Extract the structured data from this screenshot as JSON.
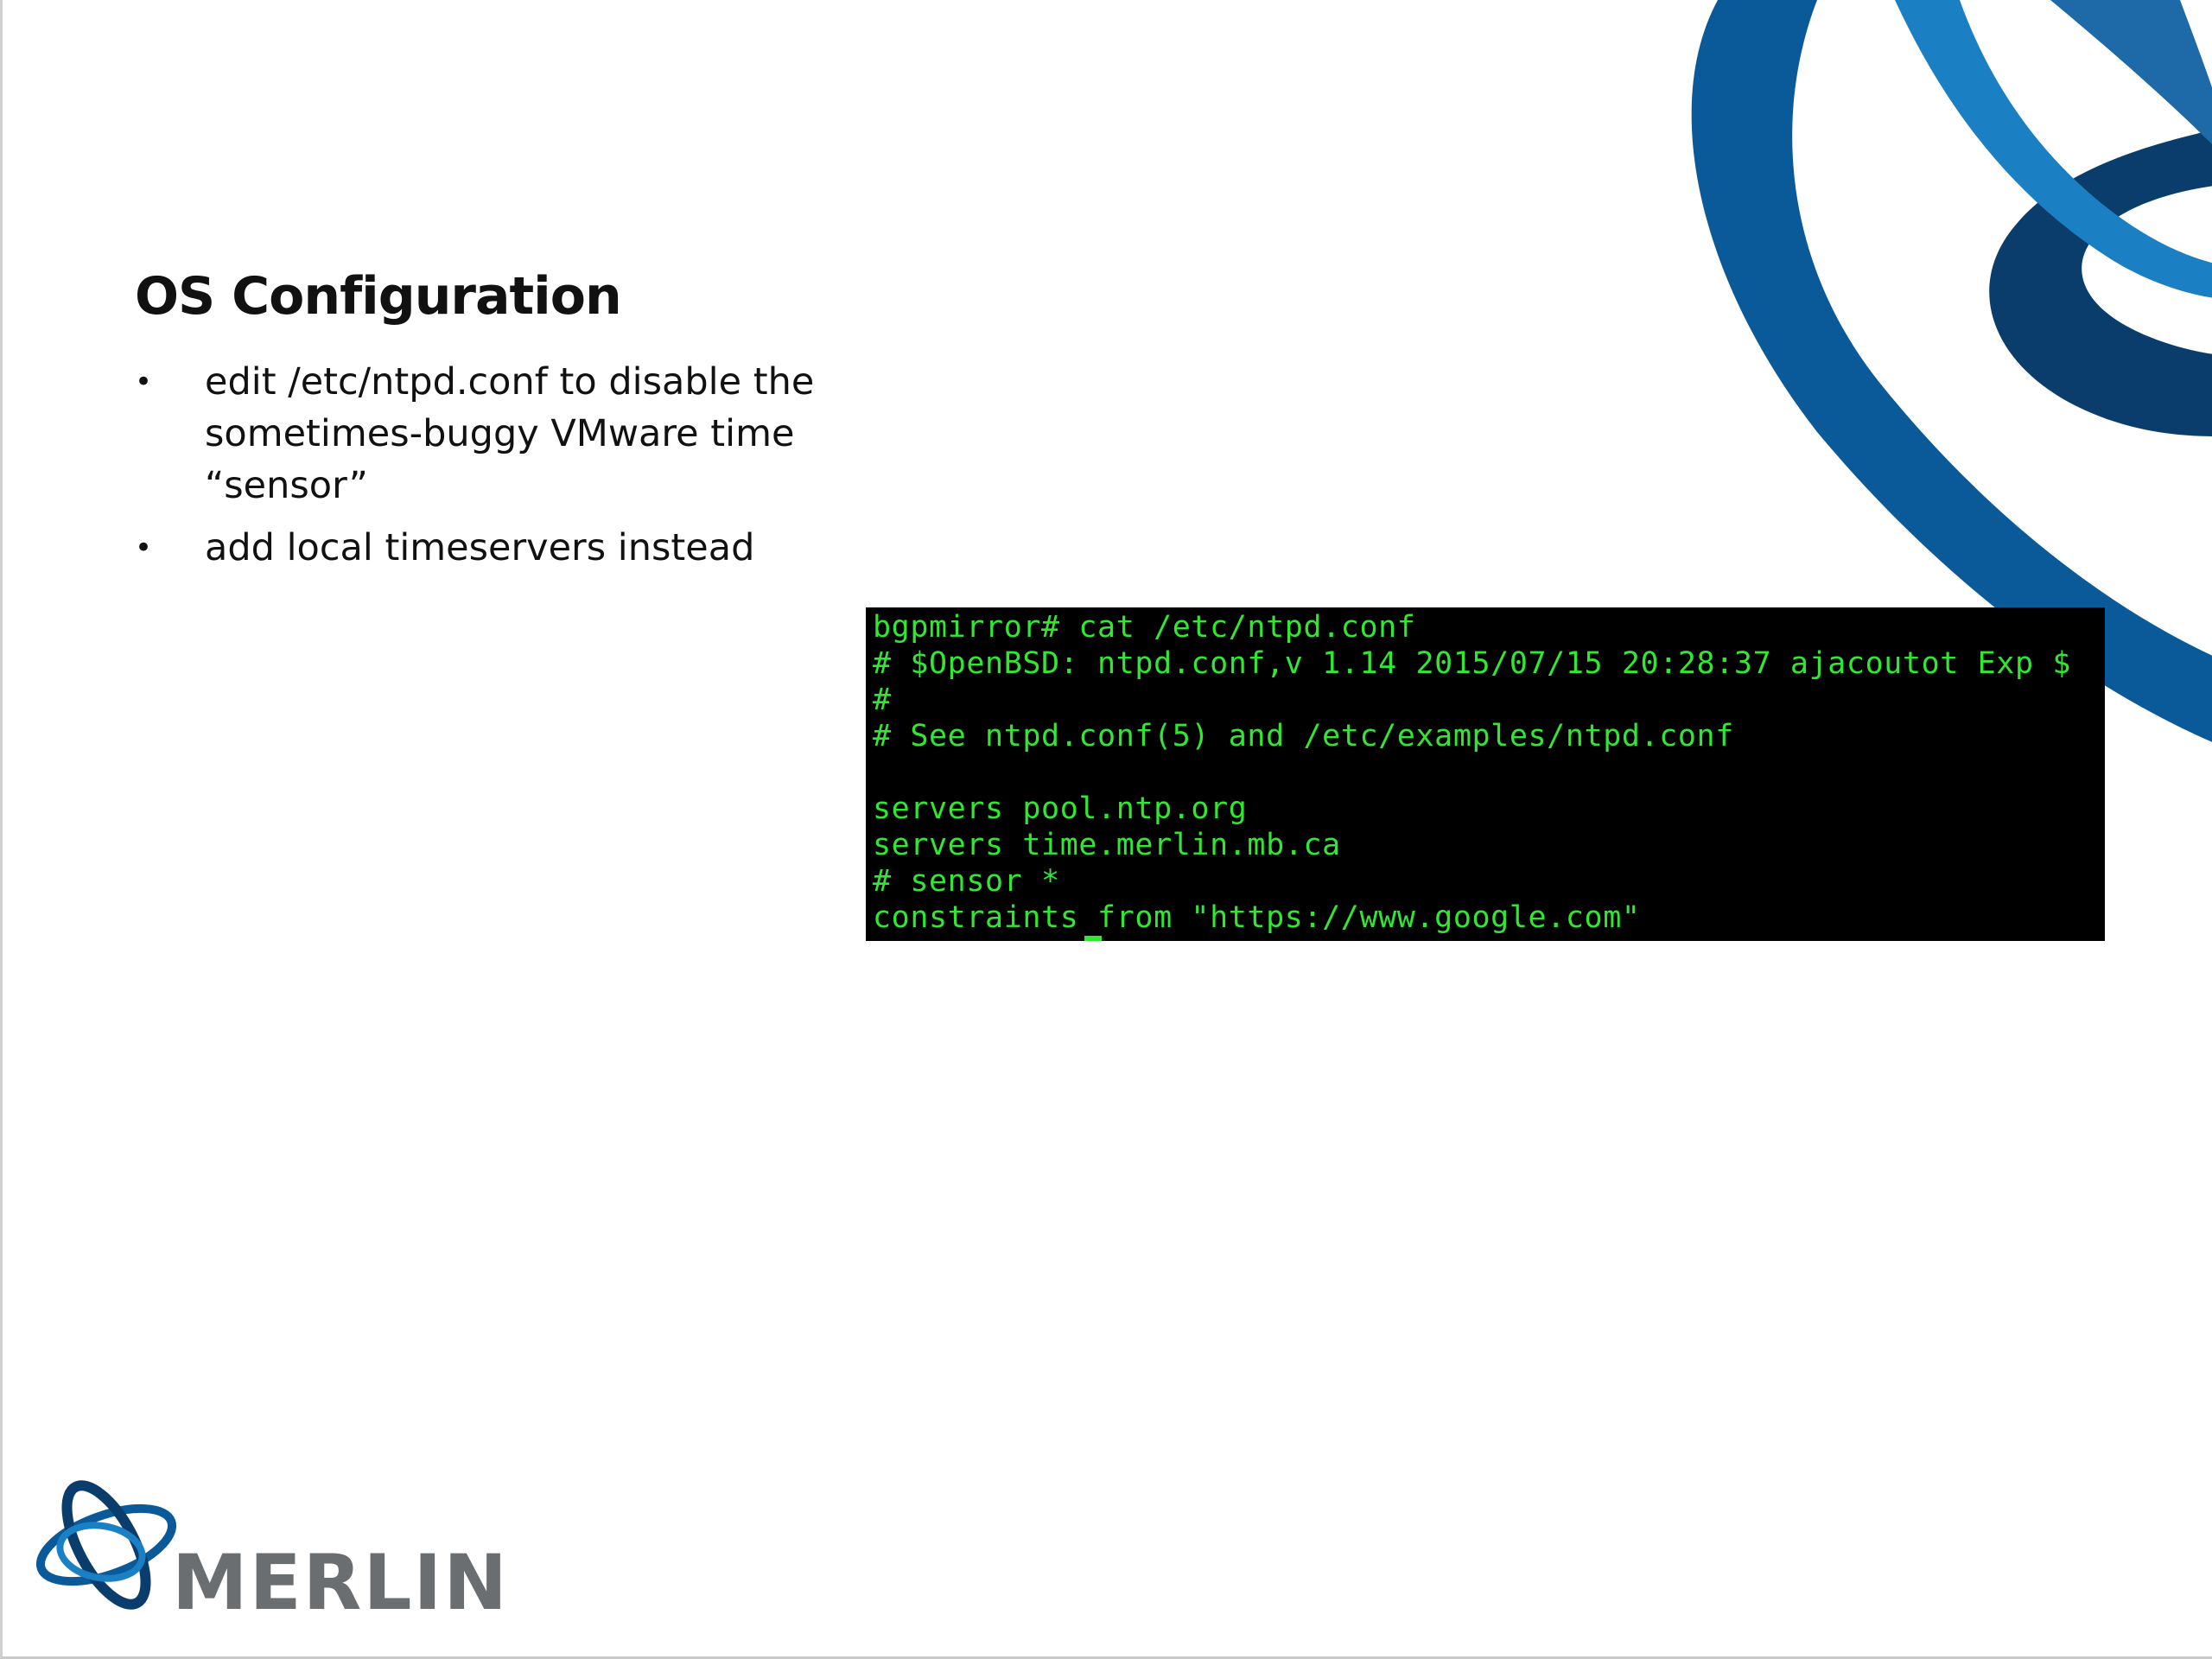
{
  "slide": {
    "title": "OS Configuration",
    "bullets": [
      {
        "marker": "•",
        "text": "edit /etc/ntpd.conf to disable the sometimes-buggy VMware time “sensor”"
      },
      {
        "marker": "•",
        "text": "add local timeservers instead"
      }
    ]
  },
  "terminal": {
    "lines": [
      "bgpmirror# cat /etc/ntpd.conf",
      "# $OpenBSD: ntpd.conf,v 1.14 2015/07/15 20:28:37 ajacoutot Exp $",
      "#",
      "# See ntpd.conf(5) and /etc/examples/ntpd.conf",
      "",
      "servers pool.ntp.org",
      "servers time.merlin.mb.ca",
      "# sensor *",
      "constraints from \"https://www.google.com\""
    ],
    "text_color": "#31e731",
    "background": "#000000"
  },
  "branding": {
    "logo_text": "MERLIN",
    "logo_icon": "merlin-orbit-logo-icon",
    "decoration_icon": "blue-swoosh-decoration",
    "colors": {
      "navy": "#0a3d6b",
      "blue": "#0a5a9a",
      "light_blue": "#1b7fc4",
      "logo_gray": "#6b6e70"
    }
  }
}
